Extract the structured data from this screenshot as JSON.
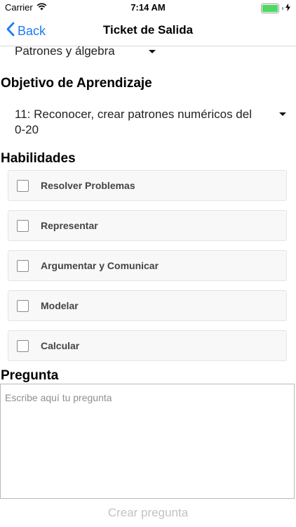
{
  "status_bar": {
    "carrier": "Carrier",
    "time": "7:14 AM",
    "battery_level": 1.0
  },
  "nav": {
    "back_label": "Back",
    "title": "Ticket de Salida"
  },
  "eje": {
    "selected": "Patrones y álgebra"
  },
  "objetivo": {
    "title": "Objetivo de Aprendizaje",
    "selected": "11: Reconocer, crear patrones numéricos del 0-20"
  },
  "habilidades": {
    "title": "Habilidades",
    "items": [
      {
        "label": "Resolver Problemas",
        "checked": false
      },
      {
        "label": "Representar",
        "checked": false
      },
      {
        "label": "Argumentar y Comunicar",
        "checked": false
      },
      {
        "label": "Modelar",
        "checked": false
      },
      {
        "label": "Calcular",
        "checked": false
      }
    ]
  },
  "pregunta": {
    "title": "Pregunta",
    "placeholder": "Escribe aquí tu pregunta",
    "value": ""
  },
  "create_button": {
    "label": "Crear pregunta",
    "enabled": false
  },
  "colors": {
    "accent": "#1a7cf5",
    "disabled_text": "#c2c2c2",
    "battery": "#4cd964"
  }
}
